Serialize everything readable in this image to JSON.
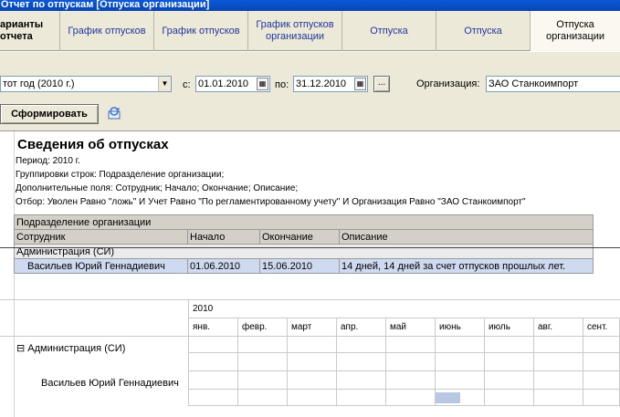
{
  "window": {
    "title": "Отчет по отпускам [Отпуска организации]"
  },
  "tabs": [
    {
      "label": "арианты\nотчета"
    },
    {
      "label": "График отпусков"
    },
    {
      "label": "График отпусков"
    },
    {
      "label": "График отпусков организации"
    },
    {
      "label": "Отпуска"
    },
    {
      "label": "Отпуска"
    },
    {
      "label": "Отпуска организации"
    }
  ],
  "toolbar": {
    "period_value": "тот год (2010 г.)",
    "from_label": "с:",
    "from_date": "01.01.2010",
    "to_label": "по:",
    "to_date": "31.12.2010",
    "dots_label": "...",
    "org_label": "Организация:",
    "org_value": "ЗАО Станкоимпорт",
    "generate_label": "Сформировать"
  },
  "report": {
    "title": "Сведения об отпусках",
    "period": "Период: 2010 г.",
    "grouping": "Группировки строк: Подразделение организации;",
    "fields": "Дополнительные поля: Сотрудник; Начало; Окончание; Описание;",
    "filter": "Отбор: Уволен Равно \"ложь\" И Учет Равно \"По регламентированному учету\" И Организация Равно \"ЗАО Станкоимпорт\"",
    "group_header": "Подразделение организации",
    "columns": [
      "Сотрудник",
      "Начало",
      "Окончание",
      "Описание"
    ],
    "dept": "Администрация (СИ)",
    "row": {
      "employee": "Васильев Юрий Геннадиевич",
      "start": "01.06.2010",
      "end": "15.06.2010",
      "description": "14 дней, 14 дней за счет отпусков прошлых лет."
    }
  },
  "calendar": {
    "year": "2010",
    "months": [
      "янв.",
      "февр.",
      "март",
      "апр.",
      "май",
      "июнь",
      "июль",
      "авг.",
      "сент."
    ],
    "dept": "Администрация (СИ)",
    "expand_symbol": "⊟",
    "employee": "Васильев Юрий Геннадиевич",
    "vacation_month": "июнь",
    "vacation_fraction_of_month": 0.5
  }
}
